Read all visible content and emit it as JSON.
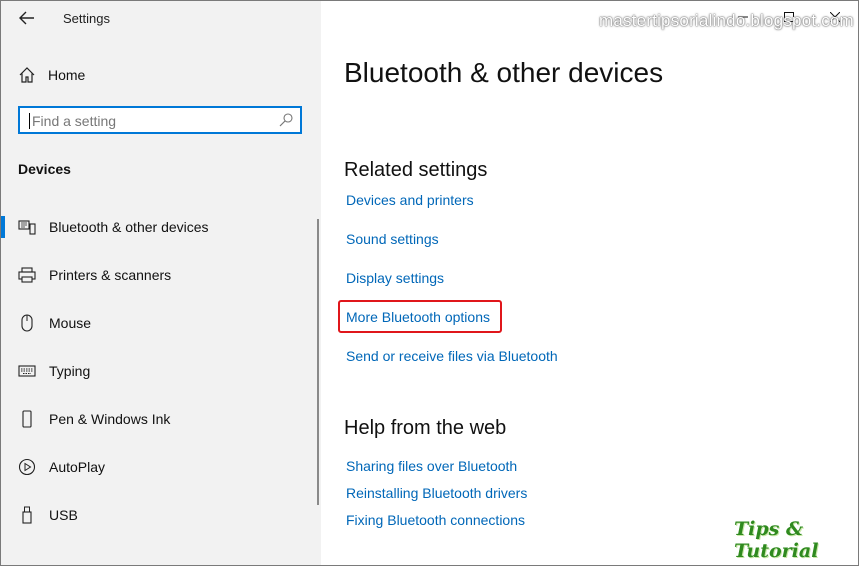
{
  "window": {
    "app_title": "Settings"
  },
  "sidebar": {
    "home_label": "Home",
    "search_placeholder": "Find a setting",
    "section_label": "Devices",
    "items": [
      {
        "label": "Bluetooth & other devices",
        "icon": "bluetooth-devices-icon",
        "active": true
      },
      {
        "label": "Printers & scanners",
        "icon": "printer-icon",
        "active": false
      },
      {
        "label": "Mouse",
        "icon": "mouse-icon",
        "active": false
      },
      {
        "label": "Typing",
        "icon": "keyboard-icon",
        "active": false
      },
      {
        "label": "Pen & Windows Ink",
        "icon": "pen-icon",
        "active": false
      },
      {
        "label": "AutoPlay",
        "icon": "autoplay-icon",
        "active": false
      },
      {
        "label": "USB",
        "icon": "usb-icon",
        "active": false
      }
    ]
  },
  "main": {
    "title": "Bluetooth & other devices",
    "related_heading": "Related settings",
    "related_links": [
      "Devices and printers",
      "Sound settings",
      "Display settings",
      "More Bluetooth options",
      "Send or receive files via Bluetooth"
    ],
    "help_heading": "Help from the web",
    "help_links": [
      "Sharing files over Bluetooth",
      "Reinstalling Bluetooth drivers",
      "Fixing Bluetooth connections"
    ]
  },
  "overlay": {
    "watermark": "mastertipsorialindo.blogspot.com",
    "logo": "Tips & Tutorial"
  },
  "colors": {
    "accent": "#0078d7",
    "link": "#0067b8",
    "highlight": "#e0161b",
    "sidebar_bg": "#f2f2f2"
  }
}
